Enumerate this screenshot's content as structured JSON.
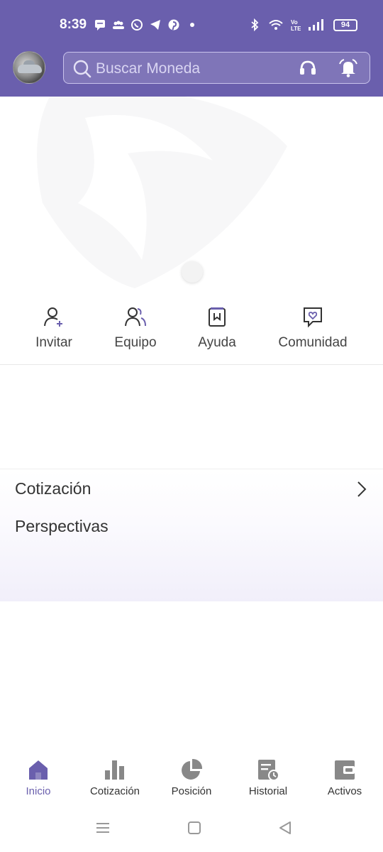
{
  "status_bar": {
    "time": "8:39",
    "battery": "94",
    "left_icons": [
      "message-icon",
      "group-icon",
      "whatsapp-icon",
      "telegram-icon",
      "pinterest-icon",
      "dot-icon"
    ],
    "right_icons": [
      "bluetooth-icon",
      "wifi-icon",
      "volte-icon",
      "signal-icon",
      "battery-icon"
    ]
  },
  "header": {
    "avatar": "profile-avatar",
    "search_placeholder": "Buscar Moneda",
    "icons": [
      "search-icon",
      "headset-icon",
      "alarm-bell-icon"
    ],
    "accent_color": "#6a5fad"
  },
  "actions": [
    {
      "label": "Invitar",
      "icon": "invite-user-icon"
    },
    {
      "label": "Equipo",
      "icon": "team-icon"
    },
    {
      "label": "Ayuda",
      "icon": "help-book-icon"
    },
    {
      "label": "Comunidad",
      "icon": "community-chat-icon"
    }
  ],
  "sections": {
    "quotes_title": "Cotización",
    "outlook_title": "Perspectivas"
  },
  "bottom_nav": [
    {
      "label": "Inicio",
      "icon": "home-icon",
      "active": true
    },
    {
      "label": "Cotización",
      "icon": "bar-chart-icon",
      "active": false
    },
    {
      "label": "Posición",
      "icon": "pie-chart-icon",
      "active": false
    },
    {
      "label": "Historial",
      "icon": "history-icon",
      "active": false
    },
    {
      "label": "Activos",
      "icon": "wallet-icon",
      "active": false
    }
  ],
  "system_nav": [
    "menu-icon",
    "home-square-icon",
    "back-triangle-icon"
  ]
}
